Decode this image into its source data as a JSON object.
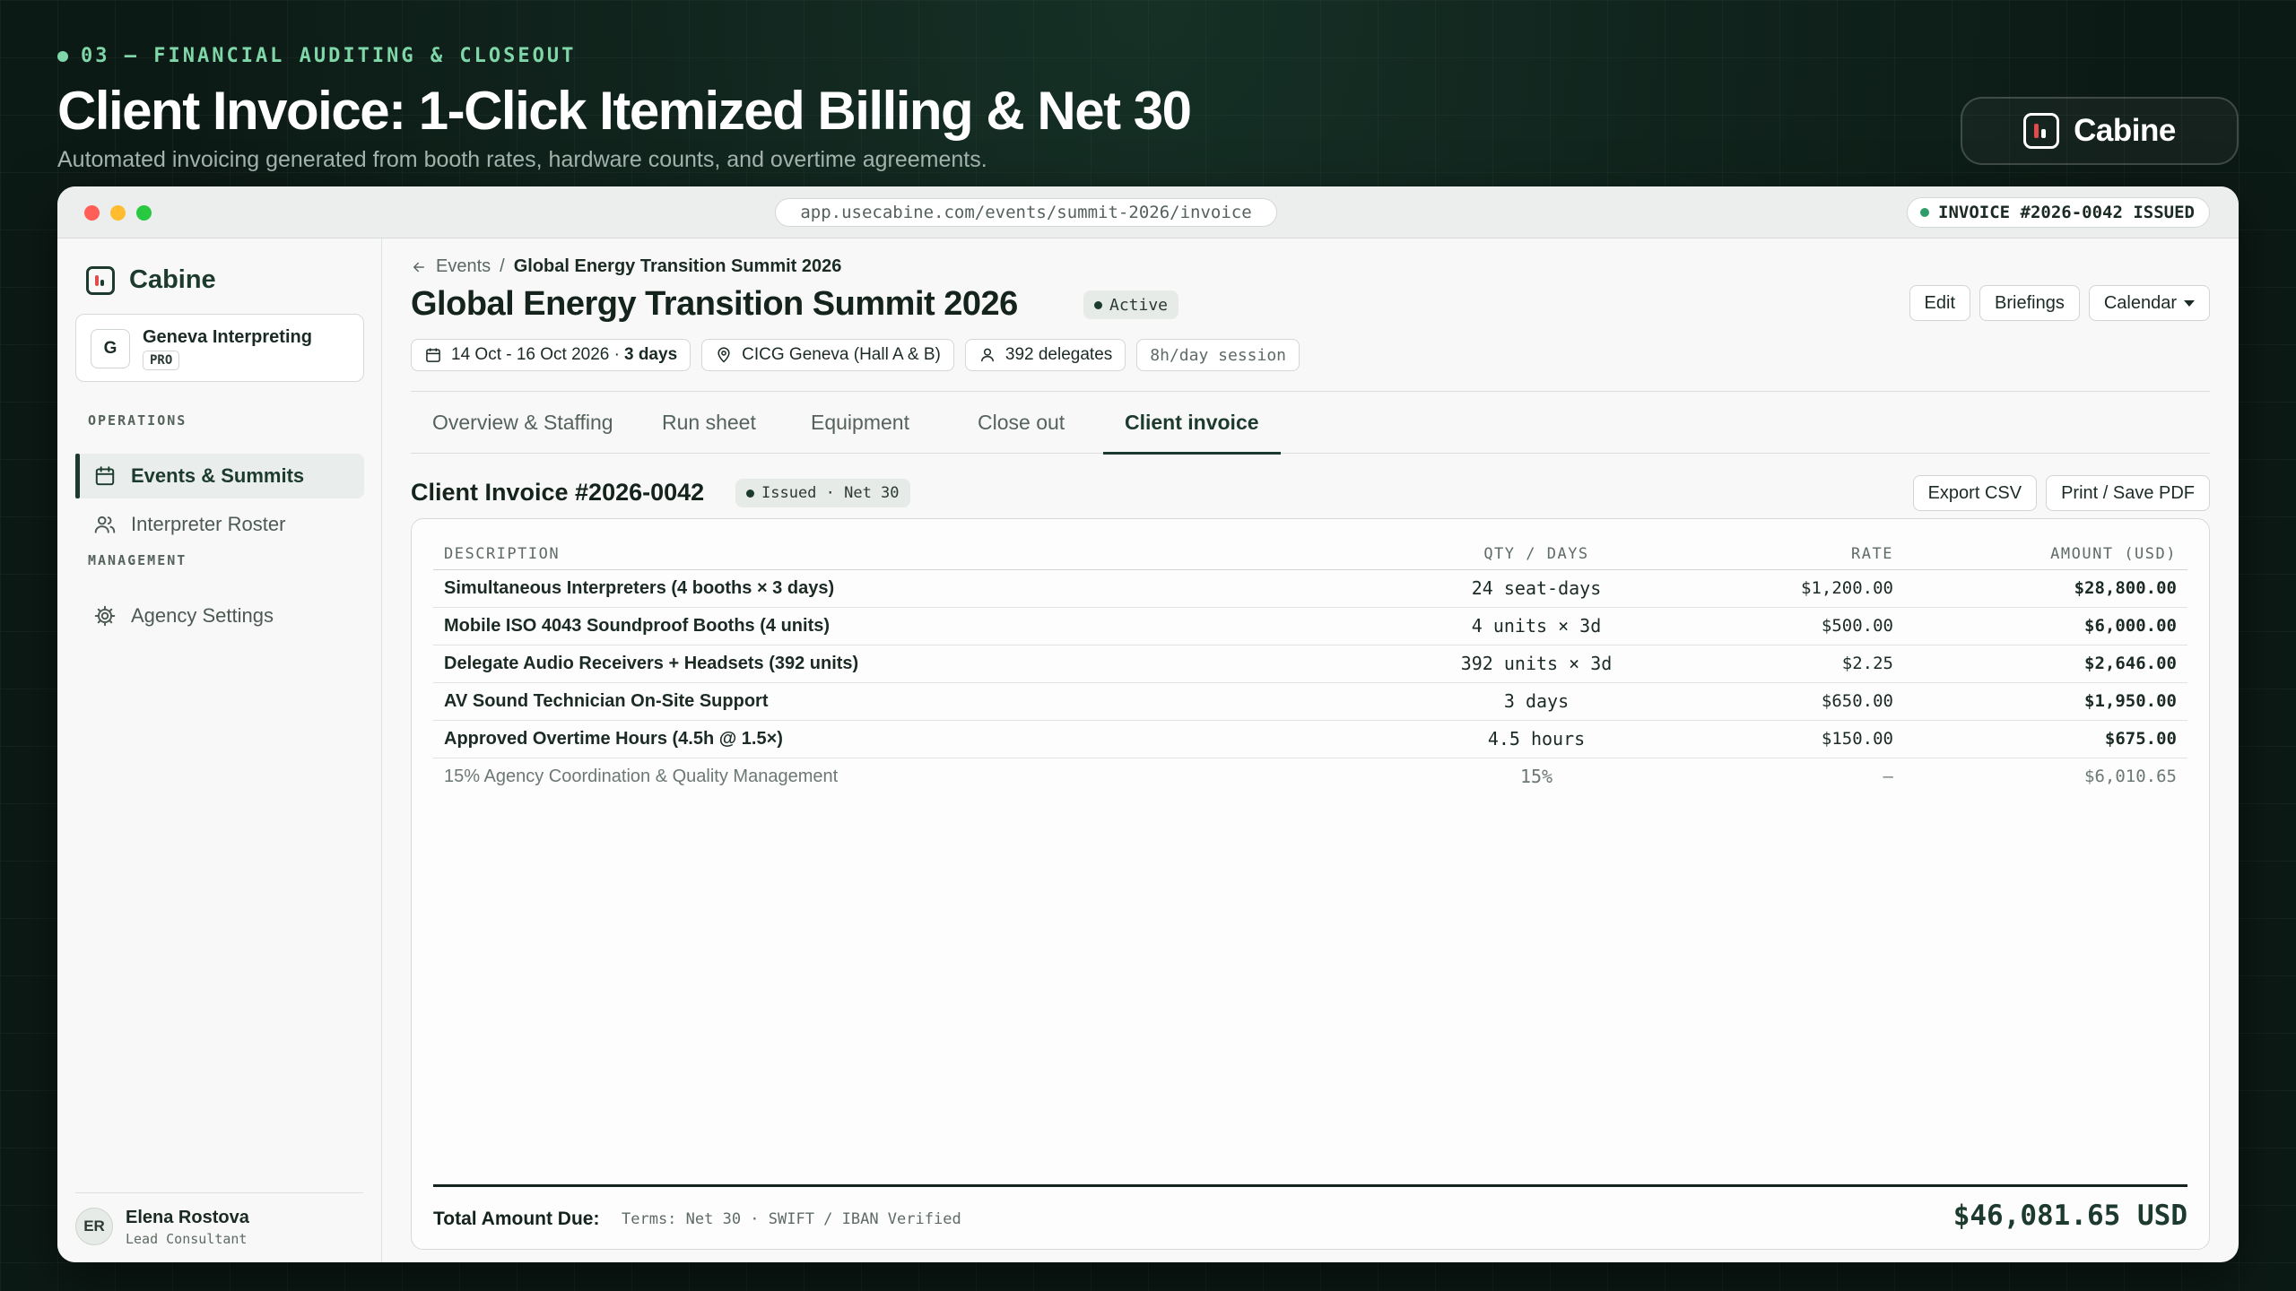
{
  "hero": {
    "eyebrow": "03 — FINANCIAL AUDITING & CLOSEOUT",
    "title": "Client Invoice: 1-Click Itemized Billing & Net 30",
    "subtitle": "Automated invoicing generated from booth rates, hardware counts, and overtime agreements.",
    "brand": "Cabine"
  },
  "browser": {
    "url": "app.usecabine.com/events/summit-2026/invoice",
    "status_chip": "INVOICE #2026-0042 ISSUED"
  },
  "sidebar": {
    "brand": "Cabine",
    "org": {
      "initial": "G",
      "name": "Geneva Interpreting",
      "badge": "PRO"
    },
    "sections": [
      {
        "label": "OPERATIONS",
        "items": [
          {
            "label": "Events & Summits",
            "icon": "calendar-icon",
            "active": true
          },
          {
            "label": "Interpreter Roster",
            "icon": "users-icon",
            "active": false
          }
        ]
      },
      {
        "label": "MANAGEMENT",
        "items": [
          {
            "label": "Agency Settings",
            "icon": "gear-icon",
            "active": false
          }
        ]
      }
    ],
    "user": {
      "initials": "ER",
      "name": "Elena Rostova",
      "role": "Lead Consultant"
    }
  },
  "main": {
    "breadcrumb": {
      "parent": "Events",
      "separator": "/",
      "current": "Global Energy Transition Summit 2026"
    },
    "title": "Global Energy Transition Summit 2026",
    "status": "Active",
    "actions": {
      "edit": "Edit",
      "briefings": "Briefings",
      "calendar": "Calendar"
    },
    "meta": {
      "dates": "14 Oct - 16 Oct 2026 ·",
      "duration": "3 days",
      "venue": "CICG Geneva (Hall A & B)",
      "delegates": "392 delegates",
      "session": "8h/day session"
    },
    "tabs": [
      "Overview & Staffing",
      "Run sheet",
      "Equipment",
      "Close out",
      "Client invoice"
    ],
    "active_tab": "Client invoice"
  },
  "invoice": {
    "title": "Client Invoice #2026-0042",
    "status": "Issued · Net 30",
    "actions": {
      "export": "Export CSV",
      "print": "Print / Save PDF"
    },
    "headers": {
      "description": "DESCRIPTION",
      "qty": "QTY / DAYS",
      "rate": "RATE",
      "amount": "AMOUNT (USD)"
    },
    "lines": [
      {
        "description": "Simultaneous Interpreters (4 booths × 3 days)",
        "qty": "24 seat-days",
        "rate": "$1,200.00",
        "amount": "$28,800.00"
      },
      {
        "description": "Mobile ISO 4043 Soundproof Booths (4 units)",
        "qty": "4 units × 3d",
        "rate": "$500.00",
        "amount": "$6,000.00"
      },
      {
        "description": "Delegate Audio Receivers + Headsets (392 units)",
        "qty": "392 units × 3d",
        "rate": "$2.25",
        "amount": "$2,646.00"
      },
      {
        "description": "AV Sound Technician On-Site Support",
        "qty": "3 days",
        "rate": "$650.00",
        "amount": "$1,950.00"
      },
      {
        "description": "Approved Overtime Hours (4.5h @ 1.5×)",
        "qty": "4.5 hours",
        "rate": "$150.00",
        "amount": "$675.00"
      }
    ],
    "fee_line": {
      "description": "15% Agency Coordination & Quality Management",
      "qty": "15%",
      "rate": "—",
      "amount": "$6,010.65"
    },
    "total": {
      "label": "Total Amount Due:",
      "terms": "Terms: Net 30 · SWIFT / IBAN Verified",
      "amount": "$46,081.65 USD"
    }
  }
}
